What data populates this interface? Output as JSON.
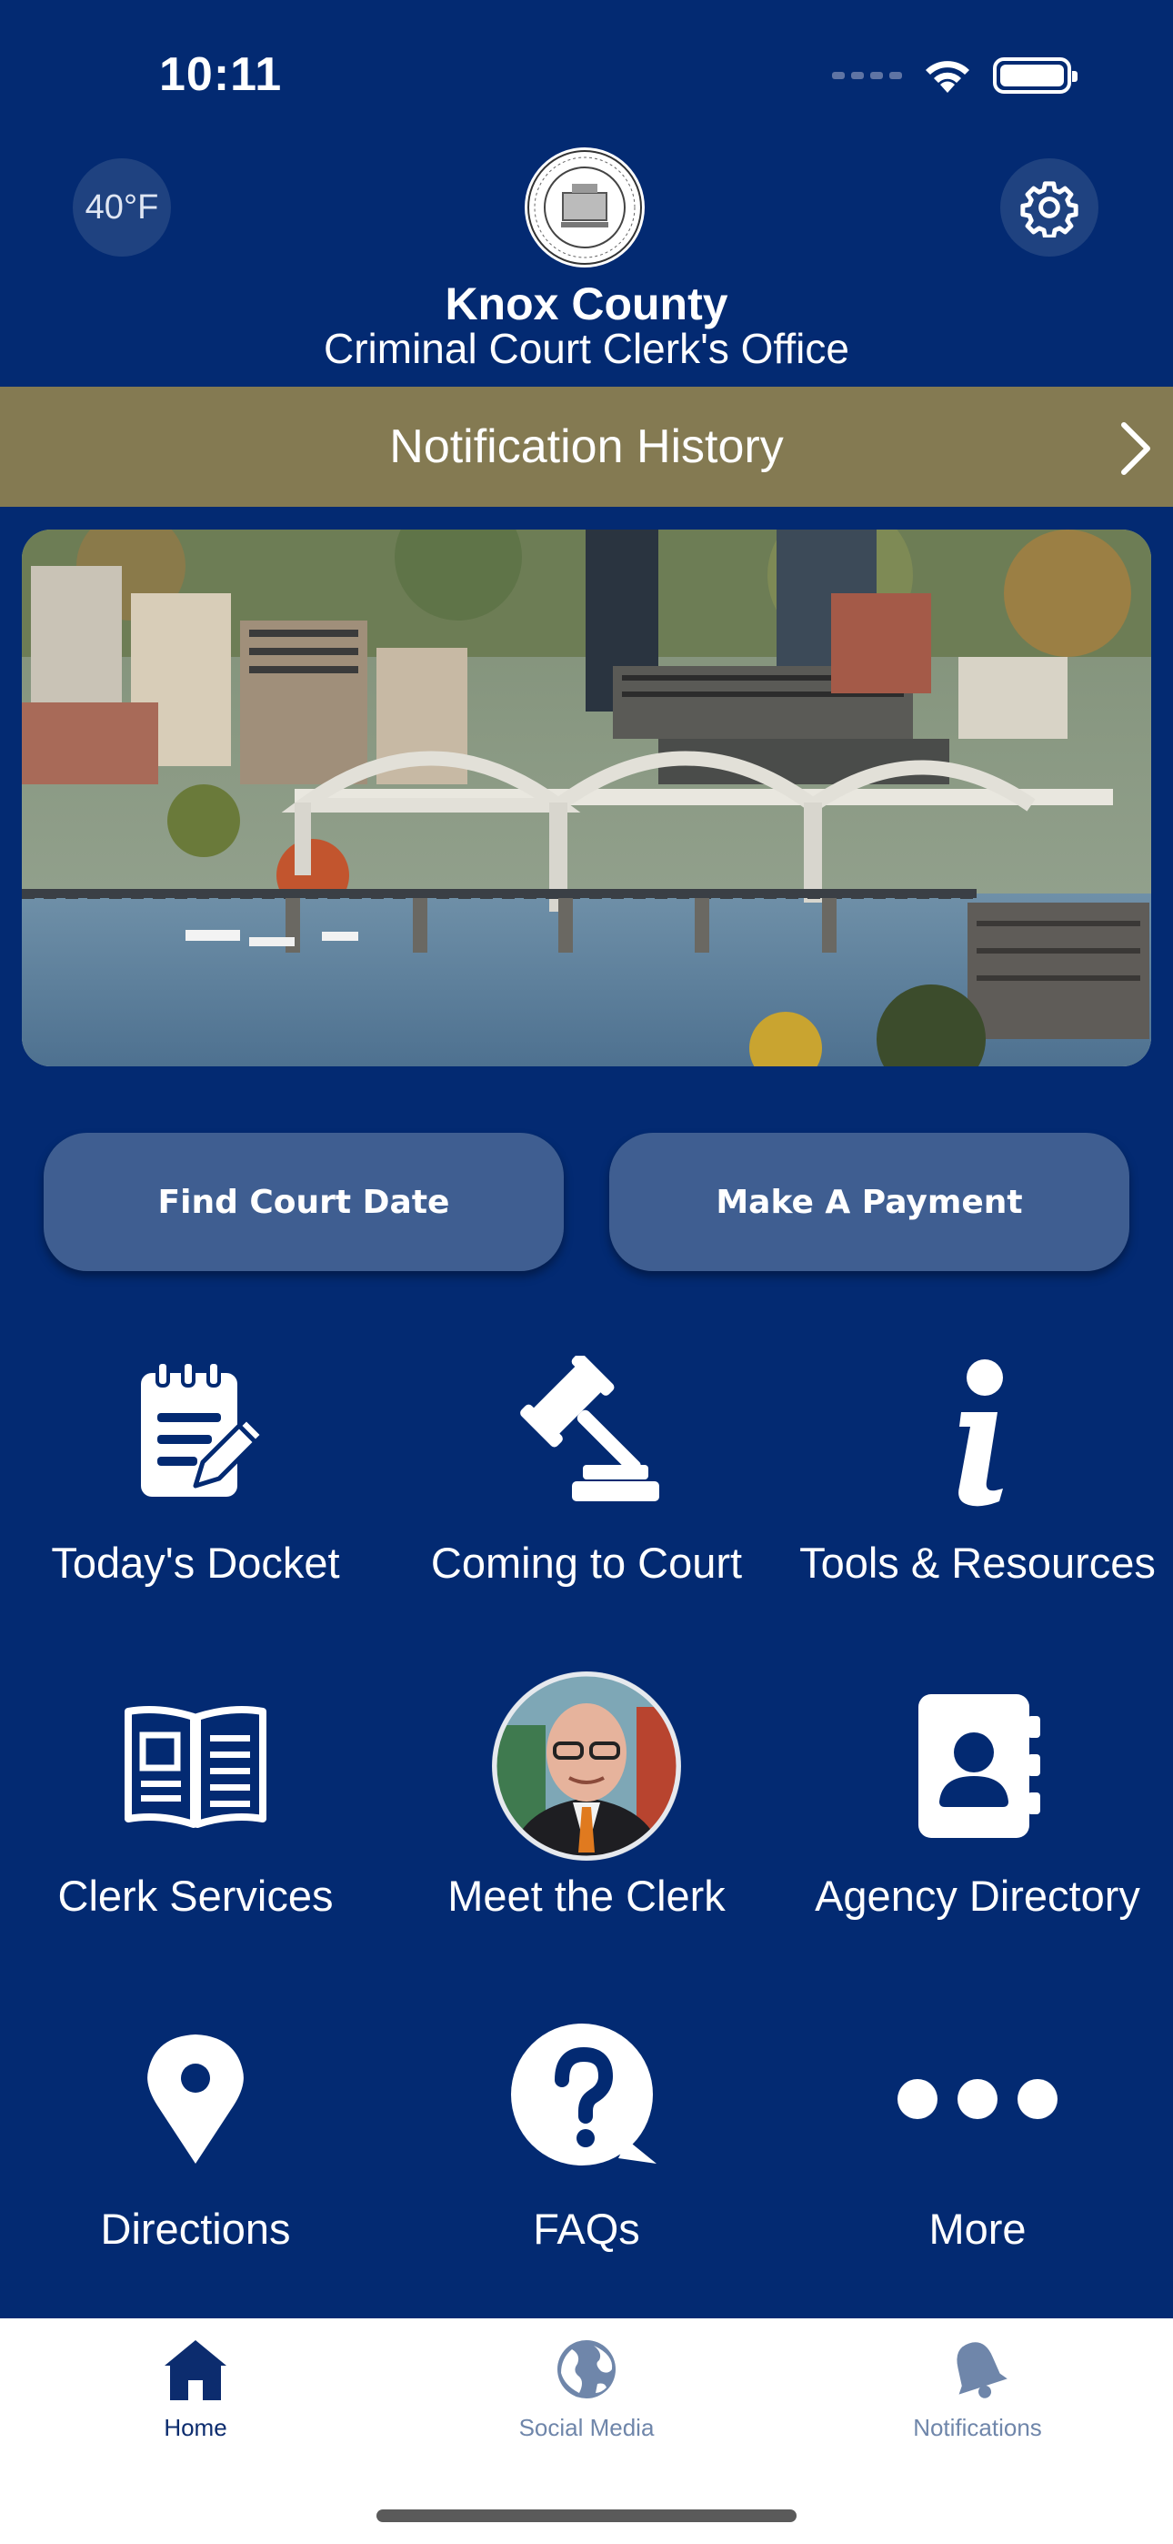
{
  "status_bar": {
    "time": "10:11"
  },
  "header": {
    "temperature": "40°F",
    "org_name": "Knox County",
    "org_subtitle": "Criminal Court Clerk's Office",
    "seal_text": "OFFICIAL SEAL · KNOX COUNTY TENN"
  },
  "notification_bar": {
    "label": "Notification History"
  },
  "hero": {
    "description": "Knoxville skyline with arched bridge over the river"
  },
  "actions": {
    "find_court_date": "Find Court Date",
    "make_payment": "Make A Payment"
  },
  "grid": [
    {
      "label": "Today's Docket",
      "icon": "docket-icon"
    },
    {
      "label": "Coming to Court",
      "icon": "gavel-icon"
    },
    {
      "label": "Tools & Resources",
      "icon": "info-icon"
    },
    {
      "label": "Clerk Services",
      "icon": "book-icon"
    },
    {
      "label": "Meet the Clerk",
      "icon": "clerk-photo"
    },
    {
      "label": "Agency Directory",
      "icon": "contact-book-icon"
    },
    {
      "label": "Directions",
      "icon": "location-pin-icon"
    },
    {
      "label": "FAQs",
      "icon": "question-bubble-icon"
    },
    {
      "label": "More",
      "icon": "more-dots-icon"
    }
  ],
  "tabs": [
    {
      "label": "Home",
      "icon": "home-icon",
      "active": true
    },
    {
      "label": "Social Media",
      "icon": "globe-icon",
      "active": false
    },
    {
      "label": "Notifications",
      "icon": "bell-icon",
      "active": false
    }
  ],
  "colors": {
    "background": "#032a72",
    "notification_bar": "#847a52",
    "button": "#3f5e91",
    "tab_active": "#0c2c6e",
    "tab_inactive": "#6f86aa"
  }
}
